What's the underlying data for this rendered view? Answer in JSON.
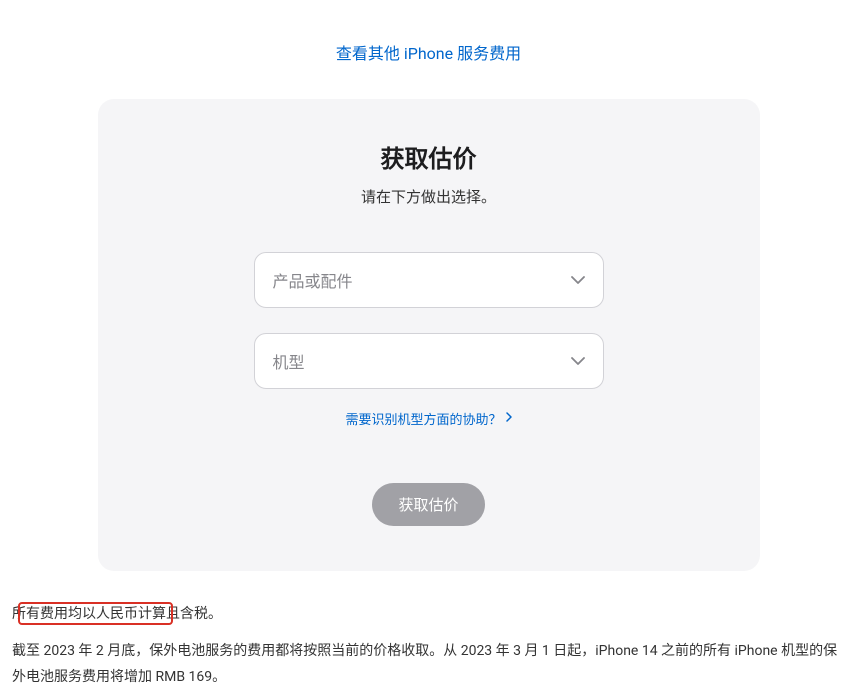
{
  "topLink": {
    "text": "查看其他 iPhone 服务费用"
  },
  "card": {
    "title": "获取估价",
    "subtitle": "请在下方做出选择。",
    "select1": {
      "placeholder": "产品或配件"
    },
    "select2": {
      "placeholder": "机型"
    },
    "helpLink": {
      "text": "需要识别机型方面的协助？"
    },
    "submitButton": {
      "label": "获取估价"
    }
  },
  "footer": {
    "line1": "所有费用均以人民币计算且含税。",
    "line2": "截至 2023 年 2 月底，保外电池服务的费用都将按照当前的价格收取。从 2023 年 3 月 1 日起，iPhone 14 之前的所有 iPhone 机型的保外电池服务费用将增加 RMB 169。"
  }
}
